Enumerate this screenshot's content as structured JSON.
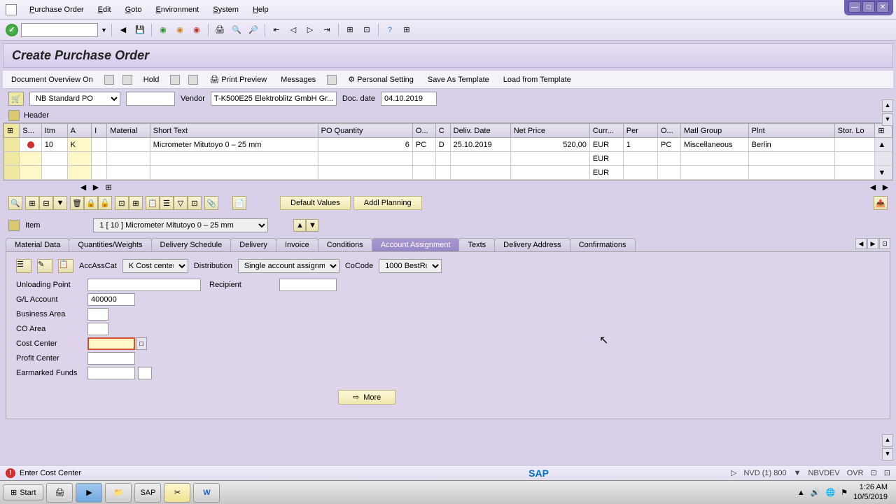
{
  "menu": [
    "Purchase Order",
    "Edit",
    "Goto",
    "Environment",
    "System",
    "Help"
  ],
  "title": "Create Purchase Order",
  "actions": {
    "doc_overview": "Document Overview On",
    "hold": "Hold",
    "print_preview": "Print Preview",
    "messages": "Messages",
    "personal": "Personal Setting",
    "save_tpl": "Save As Template",
    "load_tpl": "Load from Template"
  },
  "doc": {
    "type": "NB Standard PO",
    "vendor_label": "Vendor",
    "vendor": "T-K500E25 Elektroblitz GmbH Gr...",
    "docdate_label": "Doc. date",
    "docdate": "04.10.2019"
  },
  "header_label": "Header",
  "items": {
    "columns": [
      "S...",
      "Itm",
      "A",
      "I",
      "Material",
      "Short Text",
      "PO Quantity",
      "O...",
      "C",
      "Deliv. Date",
      "Net Price",
      "Curr...",
      "Per",
      "O...",
      "Matl Group",
      "Plnt",
      "Stor. Lo"
    ],
    "rows": [
      {
        "itm": "10",
        "a": "K",
        "short": "Micrometer Mitutoyo 0 – 25 mm",
        "qty": "6",
        "un": "PC",
        "c": "D",
        "deliv": "25.10.2019",
        "price": "520,00",
        "curr": "EUR",
        "per": "1",
        "opu": "PC",
        "matg": "Miscellaneous",
        "plnt": "Berlin"
      },
      {
        "curr": "EUR"
      },
      {
        "curr": "EUR"
      }
    ]
  },
  "item_buttons": {
    "default_values": "Default Values",
    "addl_planning": "Addl Planning"
  },
  "item_detail": {
    "label": "Item",
    "selected": "1 [ 10 ] Micrometer Mitutoyo 0 – 25 mm"
  },
  "tabs": [
    "Material Data",
    "Quantities/Weights",
    "Delivery Schedule",
    "Delivery",
    "Invoice",
    "Conditions",
    "Account Assignment",
    "Texts",
    "Delivery Address",
    "Confirmations"
  ],
  "active_tab": 6,
  "acct": {
    "accasscat_label": "AccAssCat",
    "accasscat": "K Cost center",
    "distribution_label": "Distribution",
    "distribution": "Single account assignm..",
    "cocode_label": "CoCode",
    "cocode": "1000 BestRu..",
    "unloading_label": "Unloading Point",
    "unloading": "",
    "recipient_label": "Recipient",
    "recipient": "",
    "gl_label": "G/L Account",
    "gl": "400000",
    "ba_label": "Business Area",
    "ba": "",
    "co_label": "CO Area",
    "co": "",
    "cc_label": "Cost Center",
    "cc": "",
    "pc_label": "Profit Center",
    "pc": "",
    "ef_label": "Earmarked Funds",
    "ef": "",
    "more": "More"
  },
  "status": {
    "msg": "Enter Cost Center",
    "system": "NVD (1) 800",
    "server": "NBVDEV",
    "mode": "OVR"
  },
  "taskbar": {
    "start": "Start",
    "time": "1:26 AM",
    "date": "10/5/2019"
  }
}
